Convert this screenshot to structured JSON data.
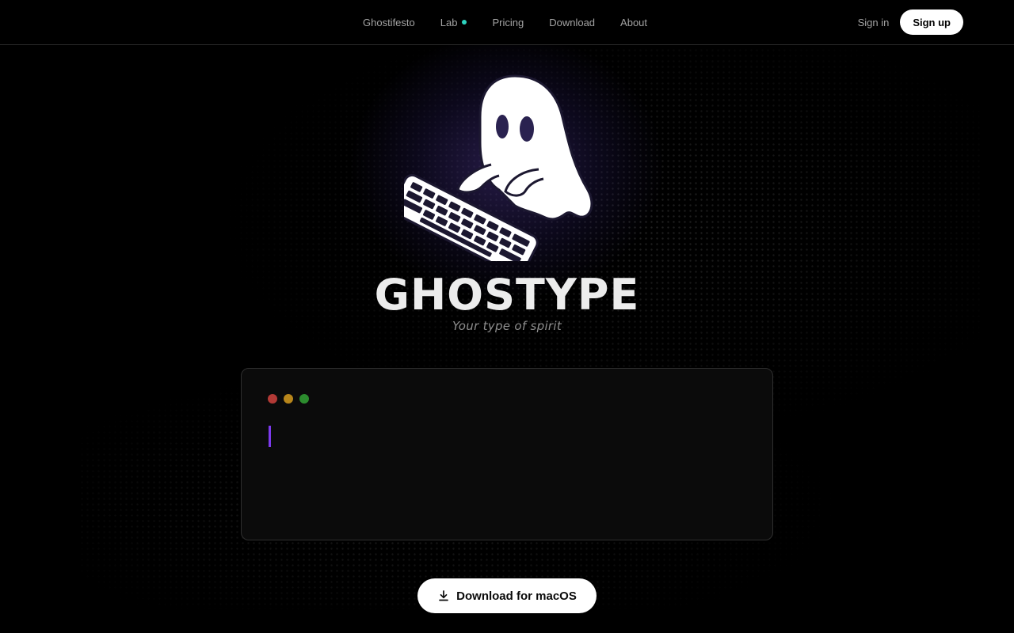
{
  "nav": {
    "items": [
      {
        "label": "Ghostifesto"
      },
      {
        "label": "Lab",
        "indicator_color": "#2dd4bf"
      },
      {
        "label": "Pricing"
      },
      {
        "label": "Download"
      },
      {
        "label": "About"
      }
    ]
  },
  "auth": {
    "sign_in": "Sign in",
    "sign_up": "Sign up"
  },
  "hero": {
    "logo_icon": "ghost-typing-keyboard-icon",
    "title": "GHOSTYPE",
    "tagline": "Your type of spirit"
  },
  "terminal": {
    "traffic_lights": [
      "#b33a36",
      "#b8861b",
      "#2c8c2e"
    ],
    "cursor_color": "#7c3aed",
    "content": ""
  },
  "cta": {
    "icon": "download-icon",
    "label": "Download for macOS"
  },
  "colors": {
    "background": "#000000",
    "accent": "#7c3aed",
    "lab_badge": "#2dd4bf"
  }
}
